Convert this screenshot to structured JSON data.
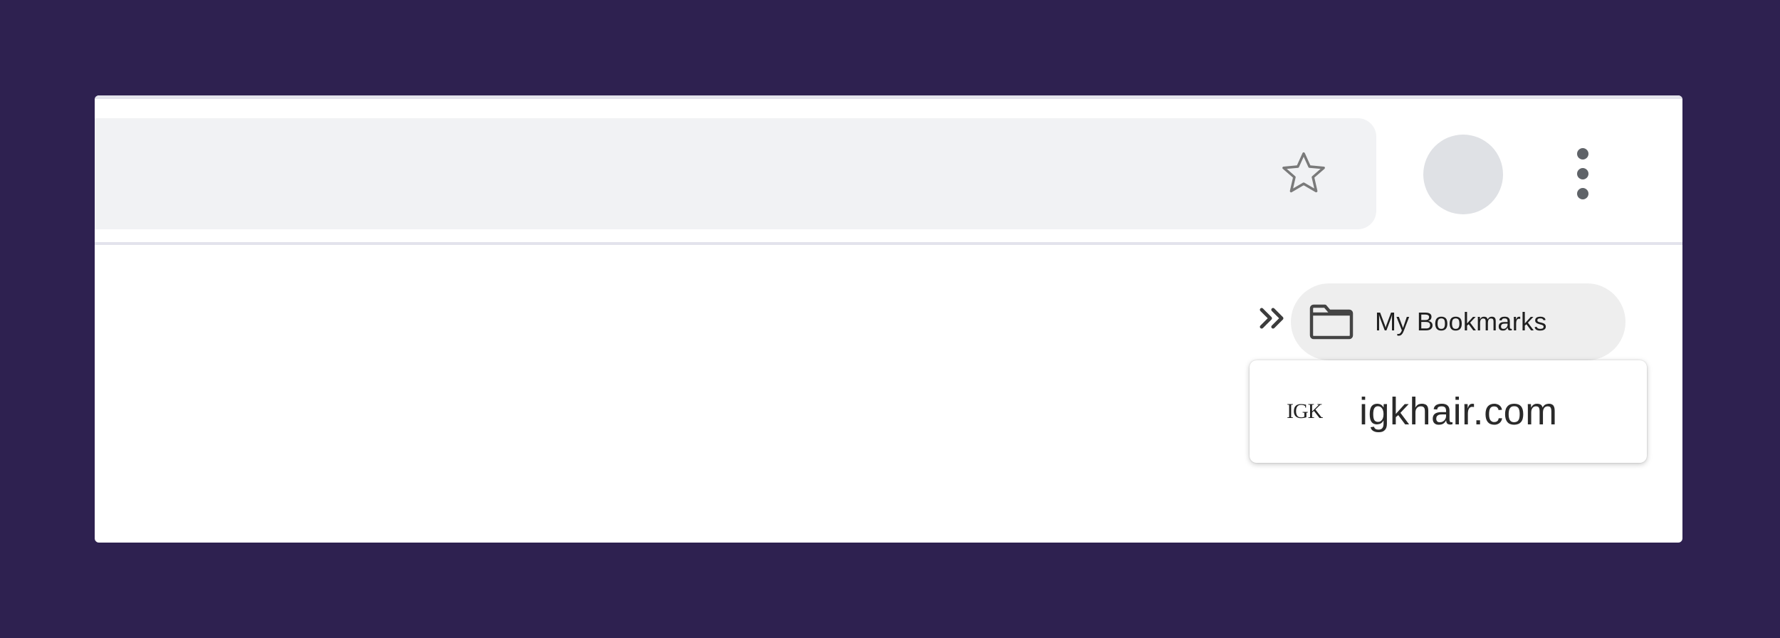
{
  "toolbar": {
    "star_icon": "star-outline-icon",
    "menu_icon": "vertical-dots-icon"
  },
  "bookmarks_bar": {
    "overflow_icon": "double-chevron-right-icon",
    "folder": {
      "label": "My Bookmarks",
      "icon": "folder-icon"
    },
    "dropdown": {
      "items": [
        {
          "favicon_text": "IGK",
          "label": "igkhair.com"
        }
      ]
    }
  },
  "colors": {
    "background": "#2e2150",
    "omnibox": "#f1f2f4",
    "avatar": "#dfe1e5",
    "folder_chip": "#eeeeee",
    "icon": "#5f6368"
  }
}
